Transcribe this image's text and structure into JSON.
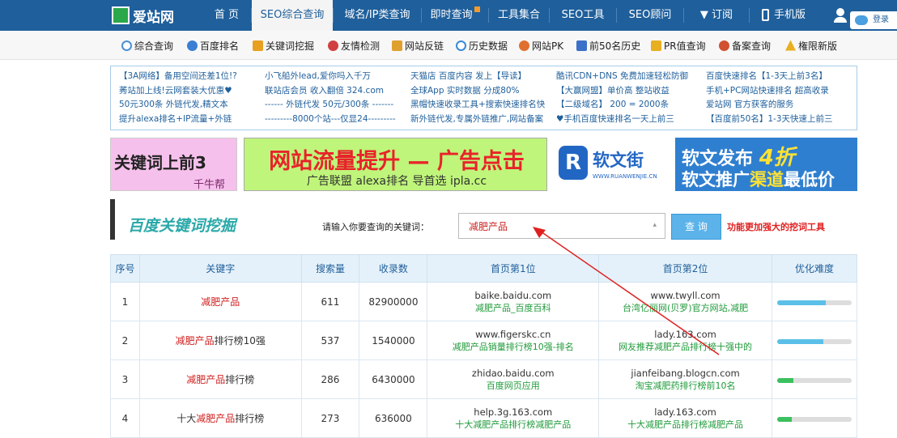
{
  "nav": {
    "logo": "爱站网",
    "tabs": [
      {
        "label": "首 页"
      },
      {
        "label": "SEO综合查询"
      },
      {
        "label": "域名/IP类查询"
      },
      {
        "label": "即时查询"
      },
      {
        "label": "工具集合"
      },
      {
        "label": "SEO工具"
      },
      {
        "label": "SEO顾问"
      },
      {
        "label": "▼ 订阅"
      },
      {
        "label": "手机版"
      }
    ],
    "login_label": "登录"
  },
  "toolbar": [
    {
      "label": "综合查询",
      "icon": "search-icon",
      "color": "#4a8fd8"
    },
    {
      "label": "百度排名",
      "icon": "baidu-paw-icon",
      "color": "#3b7fd4"
    },
    {
      "label": "关键词挖掘",
      "icon": "paper-plane-icon",
      "color": "#e8a020"
    },
    {
      "label": "友情检测",
      "icon": "link-icon",
      "color": "#d04040"
    },
    {
      "label": "网站反链",
      "icon": "pencil-icon",
      "color": "#e0a030"
    },
    {
      "label": "历史数据",
      "icon": "clock-icon",
      "color": "#3a8ad8"
    },
    {
      "label": "网站PK",
      "icon": "globe-icon",
      "color": "#e07030"
    },
    {
      "label": "前50名历史",
      "icon": "chart-icon",
      "color": "#3a70c8"
    },
    {
      "label": "PR值查询",
      "icon": "pr-icon",
      "color": "#e8b020"
    },
    {
      "label": "备案查询",
      "icon": "stamp-icon",
      "color": "#d05030"
    },
    {
      "label": "権限新版",
      "icon": "warning-icon",
      "color": "#e8b020"
    }
  ],
  "ads": {
    "col1": [
      "【3A网络】备用空间还差1位!?",
      "莠站加上线!云网套装大优惠♥",
      "50元300条 外链代发,精文本",
      "提升alexa排名+IP流量+外链"
    ],
    "col2": [
      "小飞船外lead,爱你吗入千万",
      "联站店会员 收入翻倍 324.com",
      "------ 外链代发 50元/300条 -------",
      "---------8000个站---仅显24---------"
    ],
    "col3": [
      "天猫店 百度内容 发上【导读】",
      "全球App 实时数据 分成80%",
      "黑帽快速收录工具+搜索快速排名快",
      "新外链代发,专属外链推广,网站备案"
    ],
    "col4": [
      "酷讯CDN+DNS 免费加速轻松防御",
      "【大赢网盟】单价高 整站收益",
      "【二级域名】 200 = 2000条",
      "♥手机百度快速排名一天上前三"
    ],
    "col5": [
      "百度快速排名【1-3天上前3名】",
      "手机+PC网站快速排名 超高收录",
      "爱站网 官方获客的服务",
      "【百度前50名】1-3天快速上前三"
    ]
  },
  "banners": {
    "b1_title": "关键词上前3",
    "b1_sub": "千牛帮",
    "b2_title": "网站流量提升 — 广告点击",
    "b2_sub": "广告联盟 alexa排名 导首选 ipla.cc",
    "b3_logo": "软文街",
    "b3_url": "WWW.RUANWENJIE.CN",
    "b3_title": "软文发布",
    "b3_discount": "4折",
    "b3_line2_a": "软文推广",
    "b3_line2_b": "渠道",
    "b3_line2_c": "最低价"
  },
  "section": {
    "title": "百度关键词挖掘",
    "input_label": "请输入你要查询的关键词：",
    "input_value": "减肥产品",
    "query_button": "查 询",
    "note": "功能更加强大的挖词工具"
  },
  "table": {
    "headers": [
      "序号",
      "关键字",
      "搜索量",
      "收录数",
      "首页第1位",
      "首页第2位",
      "优化难度"
    ],
    "rows": [
      {
        "idx": "1",
        "kw_pre": "",
        "kw_red": "减肥产品",
        "kw_post": "",
        "volume": "611",
        "indexed": "82900000",
        "p1_site": "baike.baidu.com",
        "p1_title": "减肥产品_百度百科",
        "p2_site": "www.twyll.com",
        "p2_title": "台湾亿丽网(贝罗)官方网站,减肥",
        "difficulty": 0.65,
        "bar_color": "#5bc0e8"
      },
      {
        "idx": "2",
        "kw_pre": "",
        "kw_red": "减肥产品",
        "kw_post": "排行榜10强",
        "volume": "537",
        "indexed": "1540000",
        "p1_site": "www.figerskc.cn",
        "p1_title": "减肥产品销量排行榜10强-排名",
        "p2_site": "lady.163.com",
        "p2_title": "网友推荐减肥产品排行榜十强中的",
        "difficulty": 0.62,
        "bar_color": "#5bc0e8"
      },
      {
        "idx": "3",
        "kw_pre": "",
        "kw_red": "减肥产品",
        "kw_post": "排行榜",
        "volume": "286",
        "indexed": "6430000",
        "p1_site": "zhidao.baidu.com",
        "p1_title": "百度网页应用",
        "p2_site": "jianfeibang.blogcn.com",
        "p2_title": "淘宝减肥药排行榜前10名",
        "difficulty": 0.22,
        "bar_color": "#3cc060"
      },
      {
        "idx": "4",
        "kw_pre": "十大",
        "kw_red": "减肥产品",
        "kw_post": "排行榜",
        "volume": "273",
        "indexed": "636000",
        "p1_site": "help.3g.163.com",
        "p1_title": "十大减肥产品排行榜减肥产品",
        "p2_site": "lady.163.com",
        "p2_title": "十大减肥产品排行榜减肥产品",
        "difficulty": 0.2,
        "bar_color": "#3cc060"
      }
    ]
  }
}
